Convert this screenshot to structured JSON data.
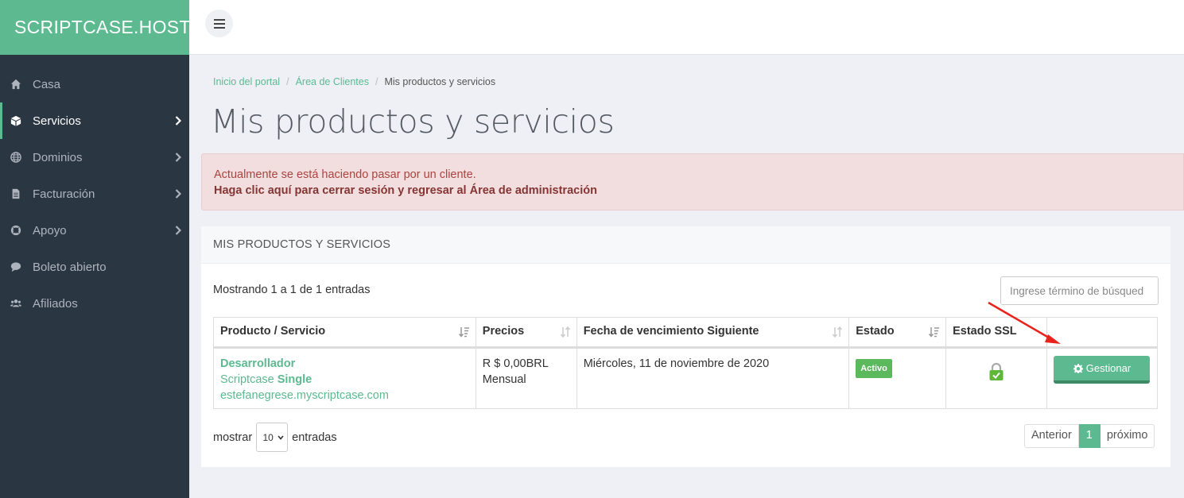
{
  "brand": "SCRIPTCASE.HOST",
  "sidebar": {
    "items": [
      {
        "label": "Casa",
        "icon": "home-icon",
        "chevron": false,
        "active": false
      },
      {
        "label": "Servicios",
        "icon": "cube-icon",
        "chevron": true,
        "active": true
      },
      {
        "label": "Dominios",
        "icon": "globe-icon",
        "chevron": true,
        "active": false
      },
      {
        "label": "Facturación",
        "icon": "file-icon",
        "chevron": true,
        "active": false
      },
      {
        "label": "Apoyo",
        "icon": "life-ring-icon",
        "chevron": true,
        "active": false
      },
      {
        "label": "Boleto abierto",
        "icon": "comment-icon",
        "chevron": false,
        "active": false
      },
      {
        "label": "Afiliados",
        "icon": "users-icon",
        "chevron": false,
        "active": false
      }
    ]
  },
  "breadcrumb": {
    "items": [
      "Inicio del portal",
      "Área de Clientes"
    ],
    "current": "Mis productos y servicios",
    "separator": "/"
  },
  "page": {
    "title": "Mis productos y servicios"
  },
  "alert": {
    "text": "Actualmente se está haciendo pasar por un cliente.",
    "link": "Haga clic aquí para cerrar sesión y regresar al Área de administración"
  },
  "panel": {
    "title": "MIS PRODUCTOS Y SERVICIOS",
    "showing": "Mostrando 1 a 1 de 1 entradas",
    "search_placeholder": "Ingrese término de búsqued",
    "columns": [
      "Producto / Servicio",
      "Precios",
      "Fecha de vencimiento Siguiente",
      "Estado",
      "Estado SSL",
      ""
    ],
    "row": {
      "product_name": "Desarrollador",
      "product_group": "Scriptcase",
      "product_group_bold": "Single",
      "domain": "estefanegrese.myscriptcase.com",
      "price": "R $ 0,00BRL",
      "cycle": "Mensual",
      "due_date": "Miércoles, 11 de noviembre de 2020",
      "status": "Activo",
      "ssl_icon": "lock-icon",
      "action": "Gestionar"
    },
    "show_label": "mostrar",
    "page_size": "10",
    "entries_label": "entradas",
    "pager": {
      "prev": "Anterior",
      "current": "1",
      "next": "próximo"
    }
  },
  "colors": {
    "accent": "#5cb990",
    "sidebar": "#2b3643",
    "alert_bg": "#f2dede",
    "alert_text": "#a94442",
    "arrow": "#e8231c"
  }
}
